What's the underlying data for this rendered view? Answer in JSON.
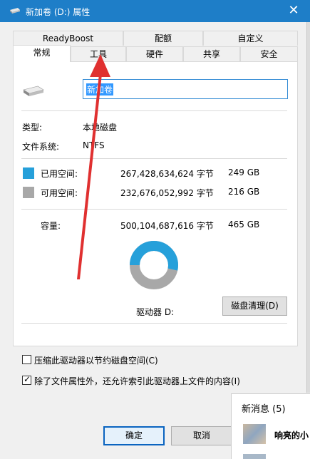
{
  "window": {
    "title": "新加卷 (D:) 属性",
    "close_glyph": "✕"
  },
  "tabs": {
    "row1": [
      "ReadyBoost",
      "配额",
      "自定义"
    ],
    "row2": [
      "常规",
      "工具",
      "硬件",
      "共享",
      "安全"
    ],
    "active": "常规"
  },
  "general": {
    "volume_name": "新加卷",
    "type_label": "类型:",
    "type_value": "本地磁盘",
    "fs_label": "文件系统:",
    "fs_value": "NTFS",
    "used_label": "已用空间:",
    "used_bytes": "267,428,634,624 字节",
    "used_gb": "249 GB",
    "used_color": "#26a0da",
    "free_label": "可用空间:",
    "free_bytes": "232,676,052,992 字节",
    "free_gb": "216 GB",
    "free_color": "#a8a8a8",
    "capacity_label": "容量:",
    "capacity_bytes": "500,104,687,616 字节",
    "capacity_gb": "465 GB",
    "used_fraction": 0.535,
    "drive_label": "驱动器 D:",
    "cleanup_button": "磁盘清理(D)",
    "compress_label": "压缩此驱动器以节约磁盘空间(C)",
    "compress_checked": false,
    "index_label": "除了文件属性外，还允许索引此驱动器上文件的内容(I)",
    "index_checked": true
  },
  "buttons": {
    "ok": "确定",
    "cancel": "取消"
  },
  "notification": {
    "header": "新消息",
    "count": "(5)",
    "sender": "响亮的小"
  },
  "colors": {
    "titlebar": "#1e7ec8",
    "annotation_arrow": "#e03030"
  }
}
